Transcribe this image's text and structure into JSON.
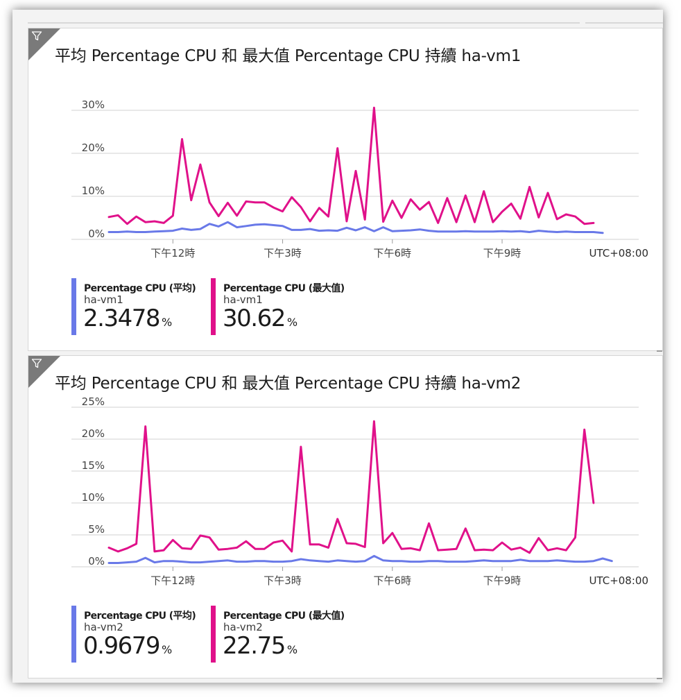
{
  "colors": {
    "avg": "#6979e8",
    "max": "#e0118a",
    "grid": "#d0d0d0",
    "text": "#444444"
  },
  "tiles": [
    {
      "title": "平均 Percentage CPU 和 最大值 Percentage CPU 持續 ha-vm1",
      "timezone": "UTC+08:00",
      "legend": [
        {
          "name": "Percentage CPU (平均)",
          "resource": "ha-vm1",
          "value": "2.3478",
          "unit": "%"
        },
        {
          "name": "Percentage CPU (最大值)",
          "resource": "ha-vm1",
          "value": "30.62",
          "unit": "%"
        }
      ]
    },
    {
      "title": "平均 Percentage CPU 和 最大值 Percentage CPU 持續 ha-vm2",
      "timezone": "UTC+08:00",
      "legend": [
        {
          "name": "Percentage CPU (平均)",
          "resource": "ha-vm2",
          "value": "0.9679",
          "unit": "%"
        },
        {
          "name": "Percentage CPU (最大值)",
          "resource": "ha-vm2",
          "value": "22.75",
          "unit": "%"
        }
      ]
    }
  ],
  "chart_data": [
    {
      "type": "line",
      "title": "平均 Percentage CPU 和 最大值 Percentage CPU 持續 ha-vm1",
      "xlabel": "",
      "ylabel": "",
      "x_ticks": [
        "下午12時",
        "下午3時",
        "下午6時",
        "下午9時"
      ],
      "x_tick_positions": [
        12,
        15,
        18,
        21
      ],
      "y_ticks": [
        "0%",
        "10%",
        "20%",
        "30%"
      ],
      "y_tick_values": [
        0,
        10,
        20,
        30
      ],
      "ylim": [
        0,
        30
      ],
      "xlim": [
        10.25,
        23.9
      ],
      "x_start": 10.25,
      "x_step": 0.25,
      "grid": true,
      "legend_position": "bottom",
      "series": [
        {
          "name": "Percentage CPU (平均)",
          "color": "#6979e8",
          "values": [
            1.7,
            1.7,
            1.8,
            1.7,
            1.7,
            1.8,
            1.9,
            2.0,
            2.5,
            2.2,
            2.4,
            3.6,
            3.0,
            4.0,
            2.8,
            3.1,
            3.4,
            3.5,
            3.3,
            3.1,
            2.2,
            2.2,
            2.4,
            2.0,
            2.1,
            2.0,
            2.7,
            2.1,
            2.8,
            1.9,
            2.8,
            1.9,
            2.0,
            2.1,
            2.3,
            2.0,
            1.8,
            1.8,
            1.8,
            1.9,
            1.8,
            1.8,
            1.8,
            1.9,
            1.8,
            1.9,
            1.7,
            2.0,
            1.8,
            1.7,
            1.8,
            1.7,
            1.7,
            1.7,
            1.5
          ]
        },
        {
          "name": "Percentage CPU (最大值)",
          "color": "#e0118a",
          "values": [
            5.2,
            5.6,
            3.6,
            5.3,
            4.0,
            4.2,
            3.8,
            5.5,
            23.3,
            9.1,
            17.4,
            8.6,
            5.4,
            8.5,
            5.5,
            8.8,
            8.6,
            8.6,
            7.4,
            6.5,
            9.8,
            7.5,
            4.2,
            7.3,
            5.3,
            21.2,
            4.2,
            15.9,
            4.6,
            30.6,
            4.1,
            9.0,
            5.0,
            9.3,
            6.9,
            8.7,
            3.8,
            9.6,
            4.0,
            10.2,
            4.0,
            11.2,
            4.0,
            6.4,
            8.3,
            4.8,
            12.2,
            5.1,
            10.8,
            4.7,
            5.8,
            5.3,
            3.6,
            3.8
          ]
        }
      ]
    },
    {
      "type": "line",
      "title": "平均 Percentage CPU 和 最大值 Percentage CPU 持續 ha-vm2",
      "xlabel": "",
      "ylabel": "",
      "x_ticks": [
        "下午12時",
        "下午3時",
        "下午6時",
        "下午9時"
      ],
      "x_tick_positions": [
        12,
        15,
        18,
        21
      ],
      "y_ticks": [
        "0%",
        "5%",
        "10%",
        "15%",
        "20%",
        "25%"
      ],
      "y_tick_values": [
        0,
        5,
        10,
        15,
        20,
        25
      ],
      "ylim": [
        0,
        25
      ],
      "xlim": [
        10.25,
        23.9
      ],
      "x_start": 10.25,
      "x_step": 0.25,
      "grid": true,
      "legend_position": "bottom",
      "series": [
        {
          "name": "Percentage CPU (平均)",
          "color": "#6979e8",
          "values": [
            0.6,
            0.6,
            0.7,
            0.8,
            1.4,
            0.7,
            0.9,
            0.9,
            0.8,
            0.7,
            0.7,
            0.8,
            0.9,
            1.0,
            0.8,
            0.8,
            0.9,
            0.9,
            0.8,
            0.8,
            0.9,
            1.2,
            1.0,
            0.9,
            0.8,
            1.0,
            0.9,
            0.8,
            0.9,
            1.7,
            1.0,
            0.9,
            0.9,
            0.8,
            0.8,
            0.9,
            0.9,
            0.8,
            0.8,
            0.8,
            0.9,
            1.0,
            0.9,
            0.9,
            0.9,
            1.1,
            0.9,
            0.9,
            0.9,
            1.0,
            0.9,
            0.8,
            0.8,
            0.9,
            1.3,
            0.9
          ]
        },
        {
          "name": "Percentage CPU (最大值)",
          "color": "#e0118a",
          "values": [
            3.0,
            2.4,
            2.9,
            3.6,
            22.0,
            2.4,
            2.6,
            4.2,
            2.9,
            2.8,
            4.9,
            4.6,
            2.7,
            2.8,
            3.0,
            4.0,
            2.8,
            2.8,
            3.8,
            4.1,
            2.4,
            18.8,
            3.5,
            3.5,
            3.0,
            7.5,
            3.7,
            3.6,
            3.1,
            22.8,
            3.7,
            5.3,
            2.8,
            2.9,
            2.6,
            6.8,
            2.6,
            2.7,
            2.8,
            6.0,
            2.6,
            2.7,
            2.6,
            3.8,
            2.7,
            3.0,
            2.2,
            4.5,
            2.6,
            2.9,
            2.6,
            4.6,
            21.5,
            10.0
          ]
        }
      ]
    }
  ]
}
